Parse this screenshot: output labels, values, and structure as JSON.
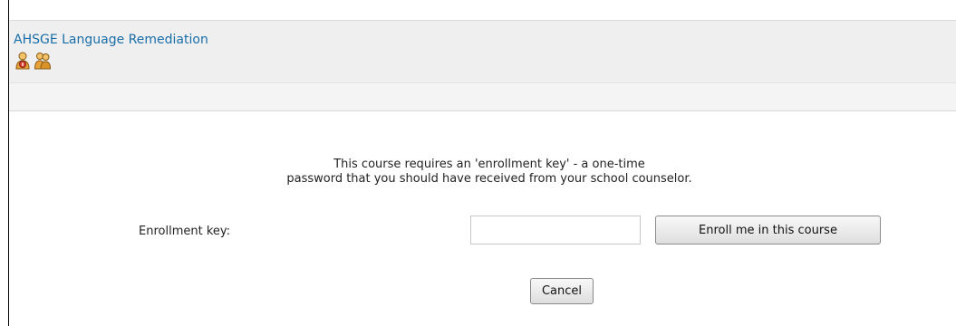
{
  "header": {
    "course_title": "AHSGE Language Remediation",
    "icons": [
      "user-info-icon",
      "group-icon"
    ]
  },
  "enrollment": {
    "notice_line1": "This course requires an 'enrollment key' - a one-time",
    "notice_line2": "password that you should have received from your school counselor.",
    "key_label": "Enrollment key:",
    "key_value": "",
    "enroll_button": "Enroll me in this course",
    "cancel_button": "Cancel"
  }
}
